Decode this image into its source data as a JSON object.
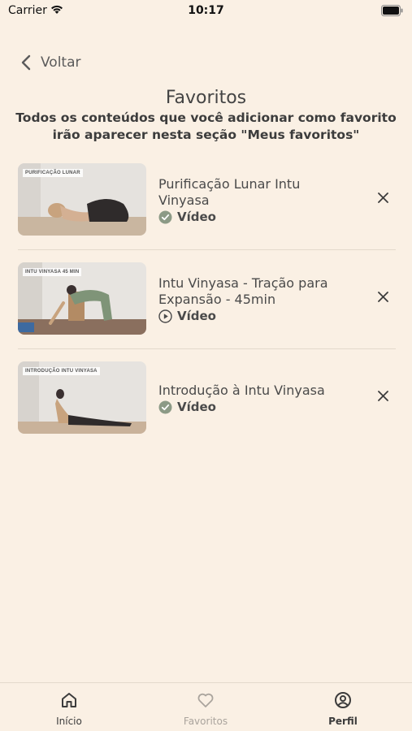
{
  "status_bar": {
    "carrier": "Carrier",
    "time": "10:17"
  },
  "nav": {
    "back_label": "Voltar"
  },
  "header": {
    "title": "Favoritos",
    "subtitle": "Todos os conteúdos que você adicionar como favorito irão aparecer nesta seção \"Meus favoritos\""
  },
  "favorites": [
    {
      "thumb_label": "PURIFICAÇÃO LUNAR",
      "title": "Purificação Lunar Intu Vinyasa",
      "type": "Vídeo",
      "status_icon": "check-circle-icon"
    },
    {
      "thumb_label": "INTU VINYASA 45 MIN",
      "title": "Intu Vinyasa - Tração para Expansão - 45min",
      "type": "Vídeo",
      "status_icon": "play-circle-icon"
    },
    {
      "thumb_label": "INTRODUÇÃO INTU VINYASA",
      "title": "Introdução à Intu Vinyasa",
      "type": "Vídeo",
      "status_icon": "check-circle-icon"
    }
  ],
  "tabbar": {
    "items": [
      {
        "label": "Início",
        "icon": "home-icon"
      },
      {
        "label": "Favoritos",
        "icon": "heart-icon"
      },
      {
        "label": "Perfil",
        "icon": "user-circle-icon"
      }
    ]
  },
  "colors": {
    "background": "#faf0e4",
    "accent_green": "#8c9a86",
    "inactive": "#aaa49d"
  }
}
